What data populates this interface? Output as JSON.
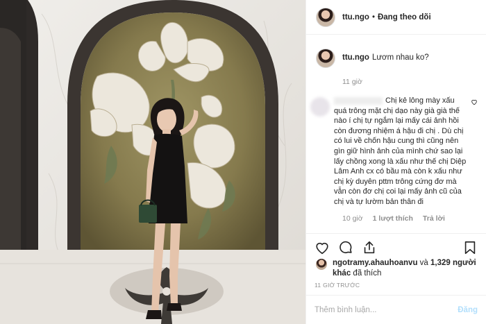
{
  "post": {
    "username": "ttu.ngo",
    "separator": "•",
    "follow_status": "Đang theo dõi",
    "caption": "Lươm nhau ko?",
    "caption_time": "11 giờ"
  },
  "comment": {
    "text": "Chị kẻ lông mày xấu quá trông mặt chị dạo này già già thế nào í chị tự ngắm lại mấy cái ảnh hồi còn đương nhiệm á hậu đi chị . Dù chị có lui về chốn hậu cung thì cũng nên gìn giữ hình ảnh của mình chứ sao lại lấy chồng xong là xấu như thế chị Diệp Lâm Anh cx có bầu mà còn k xấu như chị kỳ duyên pttm trông cứng đơ mà vẫn còn đơ chị coi lại mấy ảnh cũ của chị và tự lườm bản thân đi",
    "time": "10 giờ",
    "likes": "1 lượt thích",
    "reply": "Trả lời"
  },
  "likes": {
    "user": "ngotramy.ahauhoanvu",
    "conj": "và",
    "others": "1,329 người khác",
    "suffix": "đã thích"
  },
  "time_ago": "11 GIỜ TRƯỚC",
  "add_comment": {
    "placeholder": "Thêm bình luận...",
    "post_label": "Đăng"
  },
  "icons": {
    "like": "heart-icon",
    "comment": "comment-icon",
    "share": "share-icon",
    "save": "bookmark-icon"
  },
  "colors": {
    "text": "#262626",
    "muted": "#8e8e8e",
    "post_button": "#b2dffc",
    "border": "#efefef"
  }
}
